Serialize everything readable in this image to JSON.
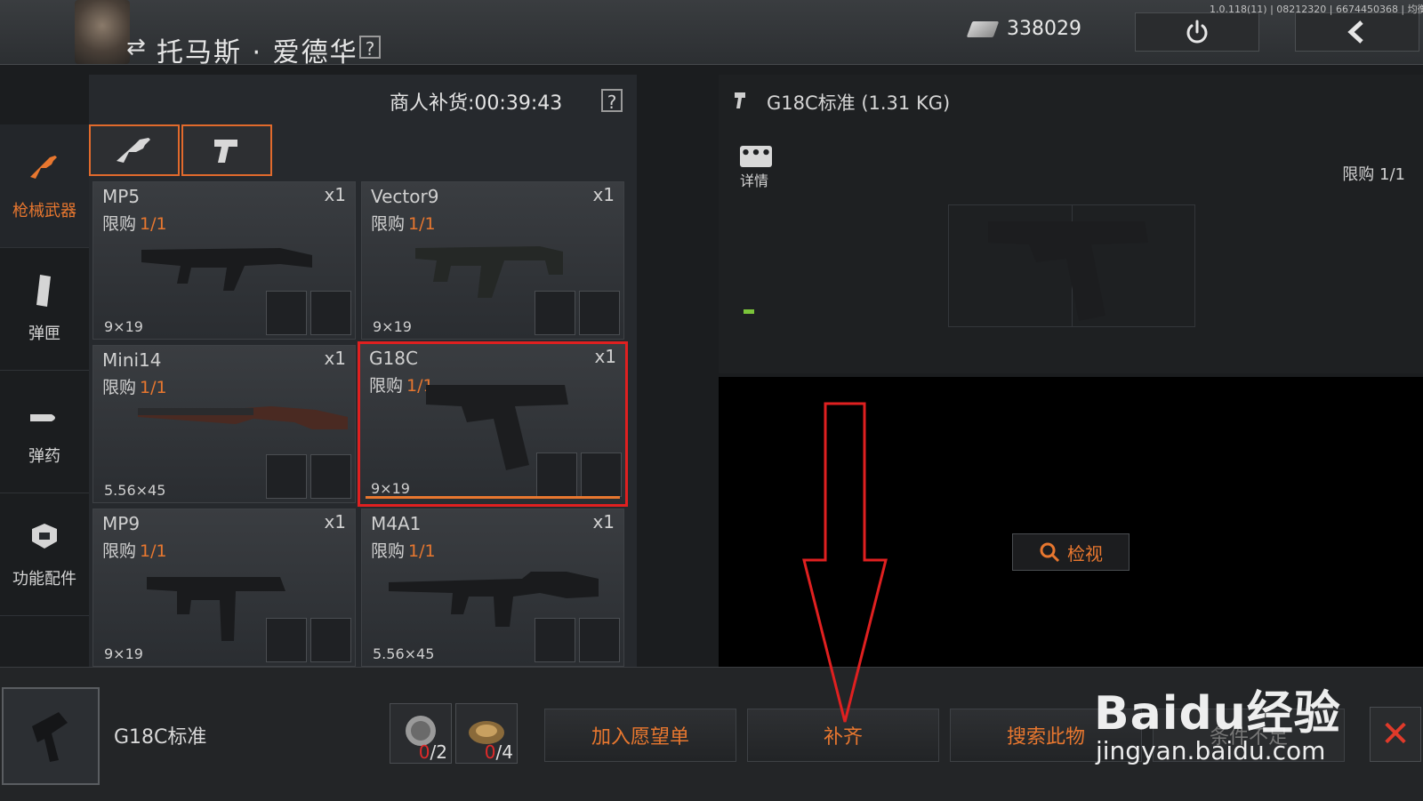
{
  "header": {
    "merchant_name": "托马斯 · 爱德华",
    "help": "?",
    "currency_value": "338029",
    "version_text": "1.0.118(11) | 08212320 | 6674450368 | 均衡"
  },
  "sidebar": {
    "items": [
      {
        "label": "枪械武器",
        "icon": "rifle-icon",
        "active": true
      },
      {
        "label": "弹匣",
        "icon": "magazine-icon",
        "active": false
      },
      {
        "label": "弹药",
        "icon": "bullet-icon",
        "active": false
      },
      {
        "label": "功能配件",
        "icon": "attachment-icon",
        "active": false
      }
    ]
  },
  "shop": {
    "restock_label": "商人补货:00:39:43",
    "help": "?",
    "subtabs": [
      "rifle-icon",
      "pistol-icon"
    ],
    "limit_prefix": "限购",
    "items": [
      {
        "name": "MP5",
        "qty": "x1",
        "limit": "1/1",
        "caliber": "9×19"
      },
      {
        "name": "Vector9",
        "qty": "x1",
        "limit": "1/1",
        "caliber": "9×19"
      },
      {
        "name": "Mini14",
        "qty": "x1",
        "limit": "1/1",
        "caliber": "5.56×45"
      },
      {
        "name": "G18C",
        "qty": "x1",
        "limit": "1/1",
        "caliber": "9×19",
        "selected": true
      },
      {
        "name": "MP9",
        "qty": "x1",
        "limit": "1/1",
        "caliber": "9×19"
      },
      {
        "name": "M4A1",
        "qty": "x1",
        "limit": "1/1",
        "caliber": "5.56×45"
      }
    ]
  },
  "detail": {
    "title": "G18C标准 (1.31 KG)",
    "more_label": "详情",
    "limit_prefix": "限购",
    "limit_value": "1/1",
    "inspect_label": "检视"
  },
  "bottom": {
    "item_name": "G18C标准",
    "materials": [
      {
        "have": "0",
        "need": "2"
      },
      {
        "have": "0",
        "need": "4"
      }
    ],
    "buttons": {
      "wishlist": "加入愿望单",
      "fill": "补齐",
      "search": "搜索此物",
      "insufficient": "条件不足"
    },
    "close": "✕"
  },
  "watermark": {
    "logo": "Baidu经验",
    "url": "jingyan.baidu.com"
  },
  "colors": {
    "accent": "#e8772f",
    "selection": "#e02020",
    "annotation_arrow": "#e02020",
    "shortage": "#e02a2a"
  }
}
